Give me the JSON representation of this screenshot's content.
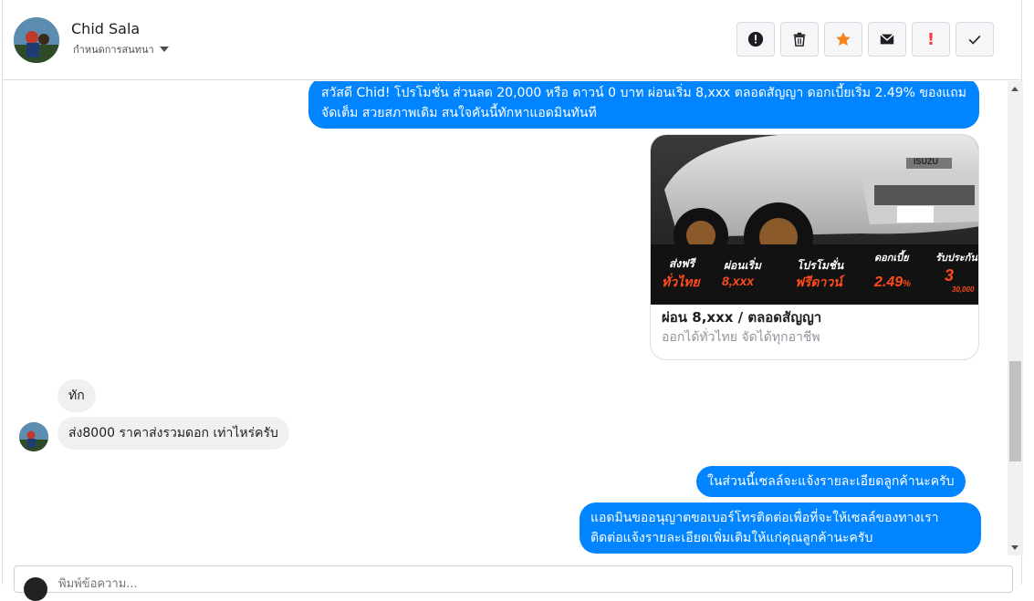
{
  "header": {
    "name": "Chid Sala",
    "subtitle": "กำหนดการสนทนา",
    "actions": [
      {
        "icon": "exclamation-circle-icon",
        "label": ""
      },
      {
        "icon": "trash-icon",
        "label": ""
      },
      {
        "icon": "star-icon",
        "label": "",
        "color": "#f5821f"
      },
      {
        "icon": "envelope-icon",
        "label": ""
      },
      {
        "icon": "important-icon",
        "label": "!",
        "color": "#fa3e3e"
      },
      {
        "icon": "check-icon",
        "label": ""
      }
    ]
  },
  "messages": {
    "promo": "สวัสดี Chid! โปรโมชั่น ส่วนลด 20,000 หรือ ดาวน์ 0 บาท ผ่อนเริ่ม 8,xxx ตลอดสัญญา ดอกเบี้ยเริ่ม 2.49% ของแถมจัดเต็ม สวยสภาพเดิม สนใจคันนี้ทักหาแอดมินทันที",
    "card": {
      "title": "ผ่อน 8,xxx / ตลอดสัญญา",
      "subtitle": "ออกได้ทั่วไทย จัดได้ทุกอาชีพ",
      "image_labels": {
        "free_ship": "ส่งฟรี",
        "free_ship_sub": "ทั่วไทย",
        "installment": "ผ่อนเริ่ม",
        "installment_value": "8,xxx",
        "promo": "โปรโมชั่น",
        "promo_sub": "ฟรีดาวน์",
        "interest": "ดอกเบี้ย",
        "interest_value": "2.49",
        "interest_unit": "%",
        "warranty": "รับประกัน",
        "warranty_value": "3",
        "warranty_km": "30,000",
        "brand": "ISUZU"
      }
    },
    "incoming_1": "ทัก",
    "incoming_2": "ส่ง8000 ราคาส่งรวมดอก เท่าไหร่ครับ",
    "outgoing_1": "ในส่วนนี้เซลล์จะแจ้งรายละเอียดลูกค้านะครับ",
    "outgoing_2": "แอดมินขออนุญาตขอเบอร์โทรติดต่อเพื่อที่จะให้เซลล์ของทางเราติดต่อแจ้งรายละเอียดเพิ่มเติมให้แก่คุณลูกค้านะครับ"
  },
  "composer": {
    "placeholder": "พิมพ์ข้อความ..."
  },
  "colors": {
    "accent": "#0084ff",
    "incoming_bg": "#f1f0f0",
    "star": "#f5821f",
    "alert": "#fa3e3e"
  }
}
